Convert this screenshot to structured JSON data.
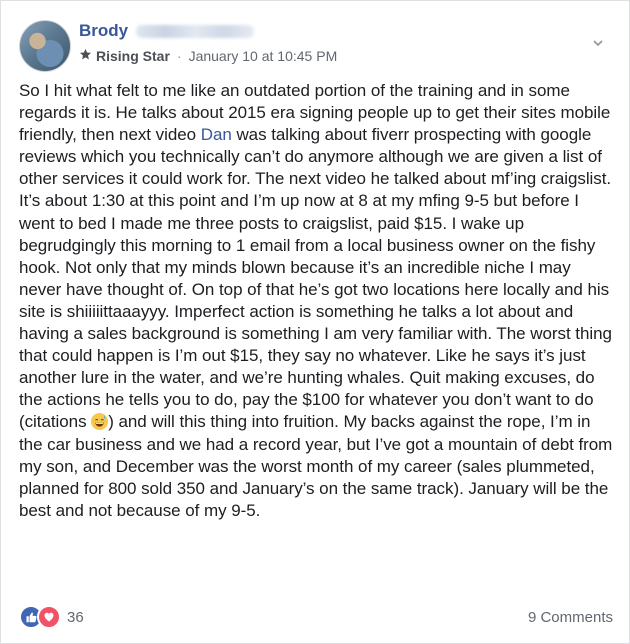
{
  "post": {
    "author": {
      "name": "Brody",
      "badge_label": "Rising Star",
      "badge_icon": "star-badge-icon"
    },
    "timestamp": "January 10 at 10:45 PM",
    "separator": "·",
    "menu_icon": "chevron-down-icon",
    "body": {
      "part1": "So I hit what felt to me like an outdated portion of the training and in some regards it is. He talks about 2015 era signing people up to get their sites mobile friendly, then next video ",
      "mention": "Dan",
      "part2": " was talking about fiverr prospecting with google reviews which you technically can’t do anymore although we are given a list of other services it could work for. The next video he talked about mf’ing craigslist. It’s about 1:30 at this point and I’m up now at 8 at my mfing 9-5 but before I went to bed I made me three posts to craigslist, paid $15. I wake up begrudgingly this morning to 1 email from a local business owner on the fishy hook. Not only that my minds blown because it’s an incredible niche I may never have thought of. On top of that he’s got two locations here locally and his site is shiiiiittaaayyy. Imperfect action is something he talks a lot about and having a sales background is something I am very familiar with. The worst thing that could happen is I’m out $15, they say no whatever. Like he says it’s just another lure in the water, and we’re hunting whales. Quit making excuses, do the actions he tells you to do, pay the $100 for whatever you don’t want to do (citations ",
      "emoji": "😅",
      "part3": ") and will this thing into fruition. My backs against the rope, I’m in the car business and we had a record year, but I’ve got a mountain of debt from my son, and December was the worst month of my career (sales plummeted, planned for 800 sold 350 and January’s on the same track). January will be the best and not because of my 9-5."
    },
    "reactions": {
      "count": "36",
      "types": [
        "like-icon",
        "love-icon"
      ]
    },
    "comments_label": "9 Comments"
  },
  "colors": {
    "link": "#385898",
    "text": "#1c1e21",
    "meta": "#616770",
    "like": "#4267b2",
    "love": "#f25268"
  }
}
